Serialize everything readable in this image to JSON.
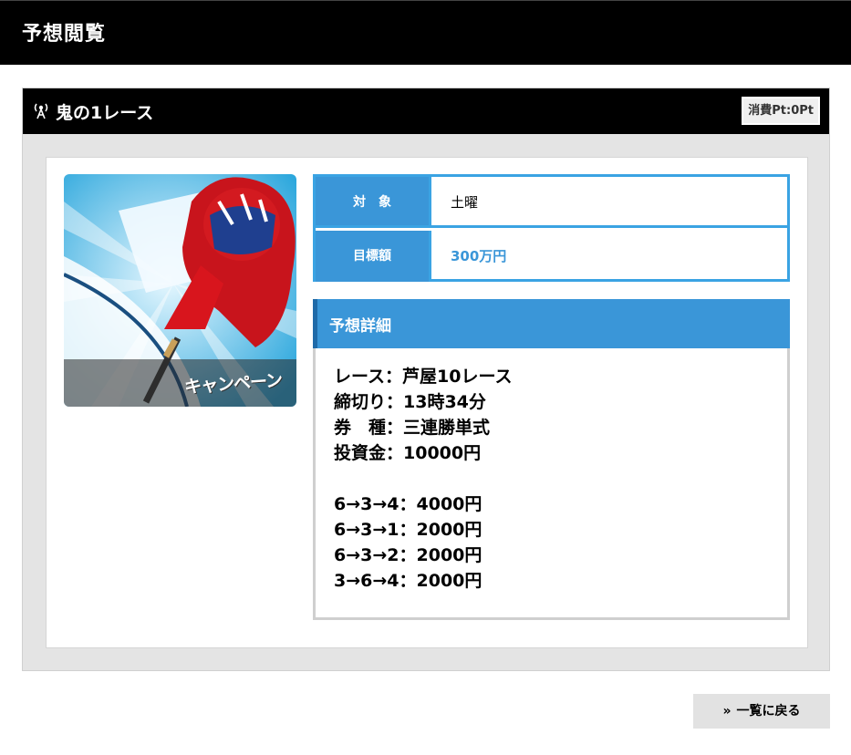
{
  "page": {
    "title": "予想閲覧"
  },
  "panel": {
    "title": "鬼の1レース",
    "cost_badge": "消費Pt:0Pt"
  },
  "thumbnail": {
    "caption": "キャンペーン"
  },
  "info": {
    "rows": [
      {
        "label": "対　象",
        "value": "土曜"
      },
      {
        "label": "目標額",
        "value": "300万円"
      }
    ]
  },
  "detail": {
    "header": "予想詳細",
    "lines": [
      "レース：芦屋10レース",
      "締切り：13時34分",
      "券　種：三連勝単式",
      "投資金：10000円"
    ],
    "bets": [
      "6→3→4：4000円",
      "6→3→1：2000円",
      "6→3→2：2000円",
      "3→6→4：2000円"
    ]
  },
  "footer": {
    "back_chevron": "»",
    "back_label": "一覧に戻る"
  },
  "colors": {
    "accent": "#3a96d8",
    "header_bg": "#000000",
    "panel_bg": "#e4e4e4"
  }
}
